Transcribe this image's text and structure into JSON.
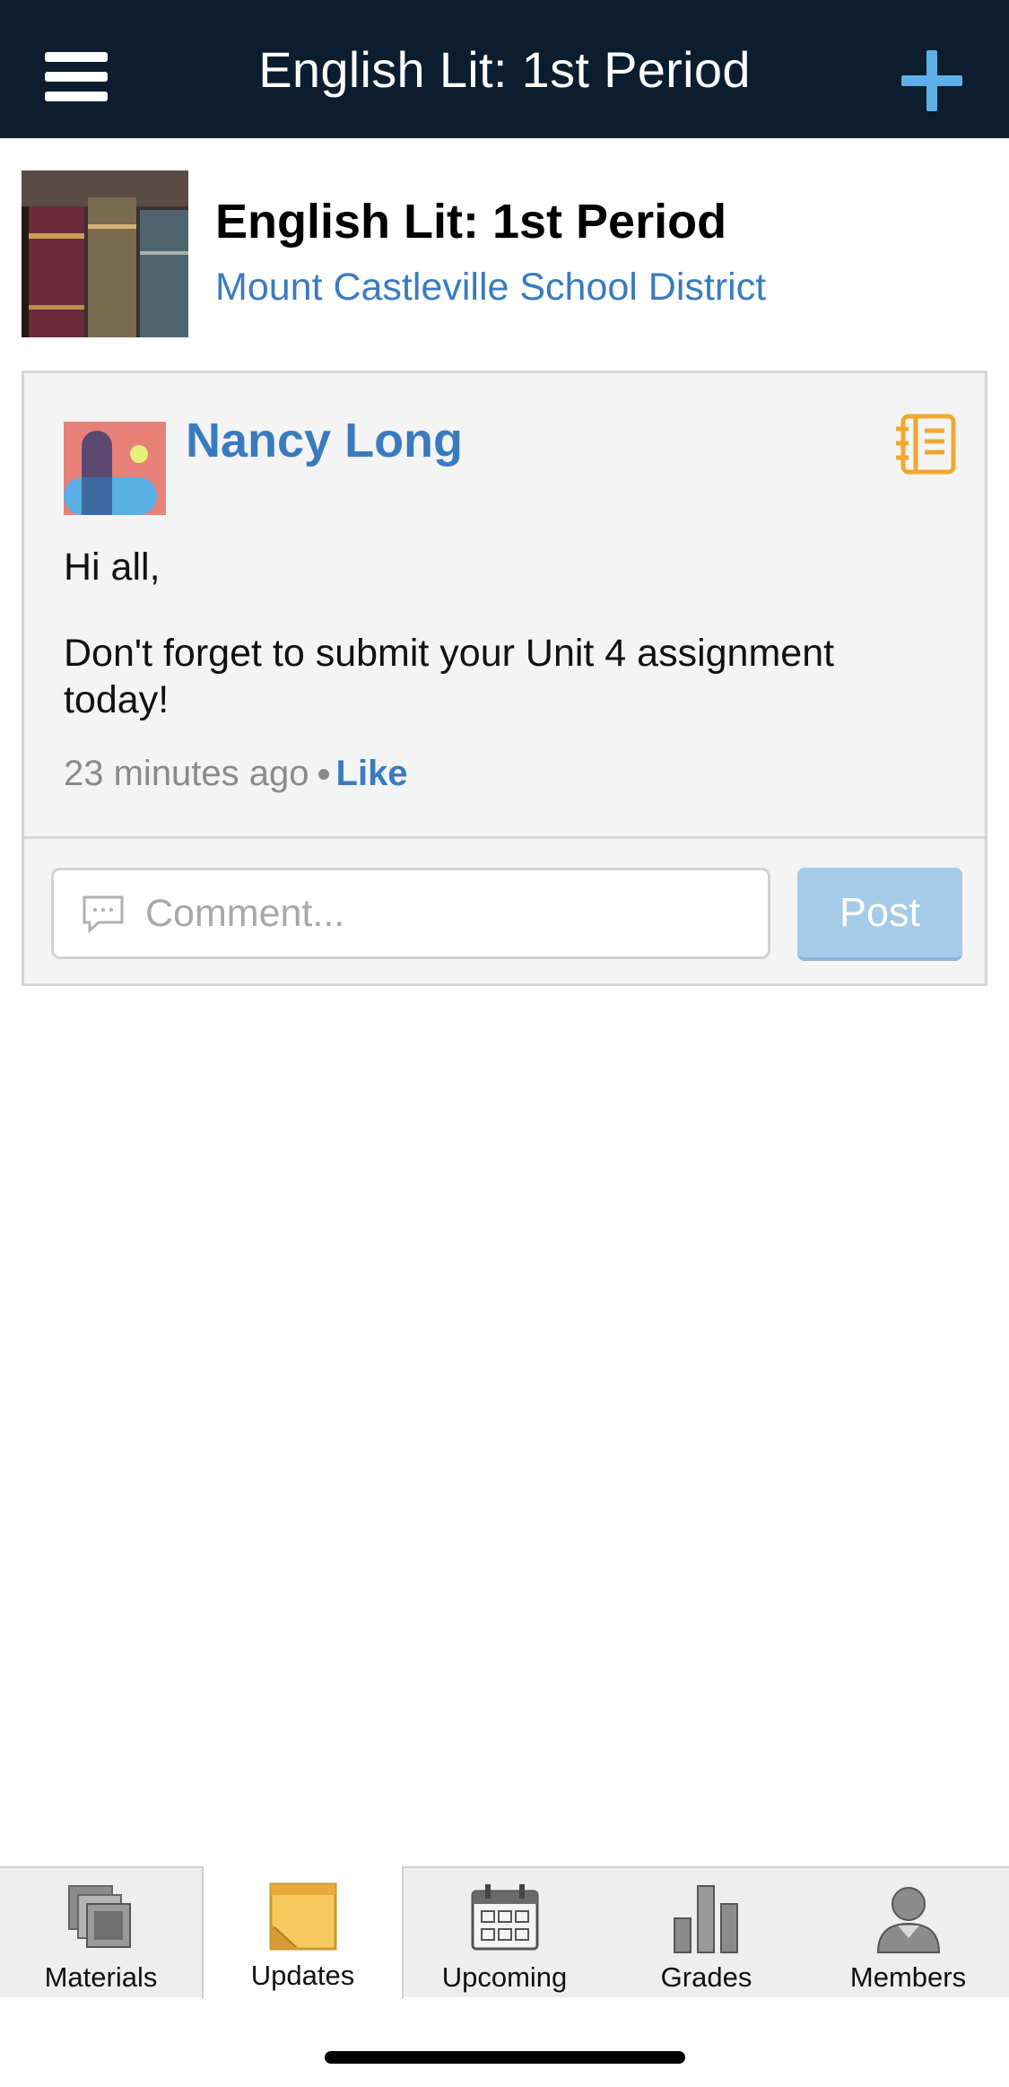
{
  "header": {
    "title": "English Lit: 1st Period",
    "menu_icon": "hamburger-icon",
    "add_icon": "plus-icon"
  },
  "course": {
    "title": "English Lit: 1st Period",
    "district": "Mount Castleville School District"
  },
  "post": {
    "author": "Nancy Long",
    "body": [
      "Hi all,",
      "Don't forget to submit your Unit 4 assignment today!"
    ],
    "time": "23 minutes ago",
    "like_label": "Like",
    "type_icon": "notebook-icon"
  },
  "comment": {
    "placeholder": "Comment...",
    "post_label": "Post"
  },
  "tabs": [
    {
      "label": "Materials",
      "icon": "materials-icon",
      "active": false
    },
    {
      "label": "Updates",
      "icon": "updates-icon",
      "active": true
    },
    {
      "label": "Upcoming",
      "icon": "calendar-icon",
      "active": false
    },
    {
      "label": "Grades",
      "icon": "grades-icon",
      "active": false
    },
    {
      "label": "Members",
      "icon": "members-icon",
      "active": false
    }
  ],
  "colors": {
    "header_bg": "#0b1d2e",
    "accent_blue": "#3a7bbf",
    "plus_blue": "#5fb0e8",
    "post_button": "#a5cbe8",
    "icon_orange": "#f0a830"
  }
}
